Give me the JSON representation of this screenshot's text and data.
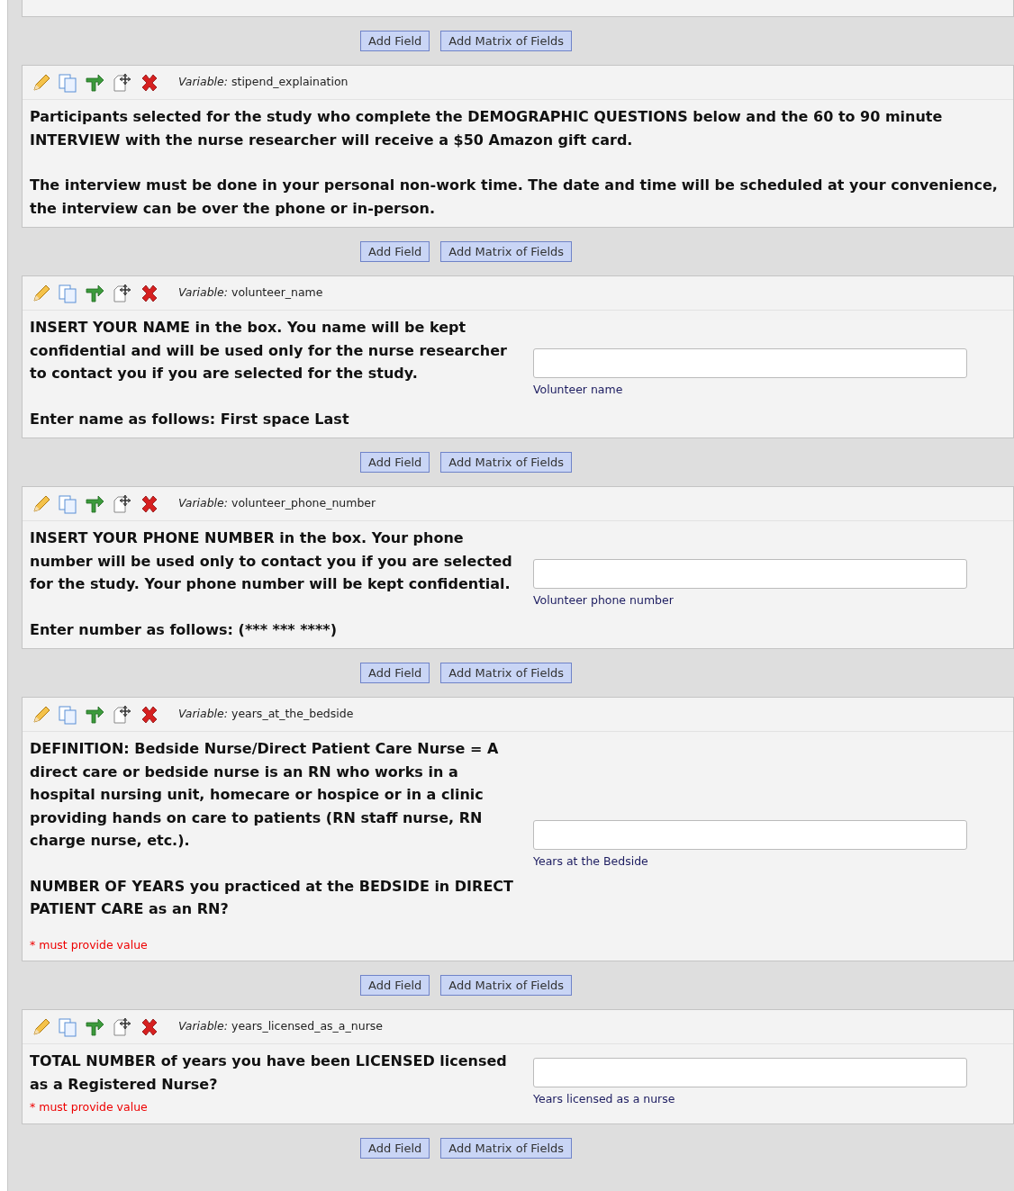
{
  "items": [
    {
      "kind": "stub"
    },
    {
      "kind": "buttons",
      "buttons": [
        "Add Field",
        "Add Matrix of Fields"
      ]
    },
    {
      "kind": "descriptive",
      "variable_label": "Variable:",
      "variable": "stipend_explaination",
      "paragraphs": [
        "Participants selected for the study who complete the DEMOGRAPHIC QUESTIONS below and the 60 to 90 minute INTERVIEW with the nurse researcher will receive a $50 Amazon gift card.",
        "The interview must be done in your personal non-work time. The date and time will be scheduled at your convenience, the interview can be over the phone or in-person."
      ]
    },
    {
      "kind": "buttons",
      "buttons": [
        "Add Field",
        "Add Matrix of Fields"
      ]
    },
    {
      "kind": "text",
      "variable_label": "Variable:",
      "variable": "volunteer_name",
      "paragraphs": [
        "INSERT YOUR NAME in the box. You name will be kept confidential and will be used only for the nurse researcher to contact you if you are selected for the study.",
        "Enter name as follows: First space Last"
      ],
      "field_note": "Volunteer name",
      "required": false
    },
    {
      "kind": "buttons",
      "buttons": [
        "Add Field",
        "Add Matrix of Fields"
      ]
    },
    {
      "kind": "text",
      "variable_label": "Variable:",
      "variable": "volunteer_phone_number",
      "paragraphs": [
        "INSERT YOUR PHONE NUMBER in the box. Your phone number will be used only to contact you if you are selected for the study. Your phone number will be kept confidential.",
        "Enter number as follows: (*** *** ****)"
      ],
      "field_note": "Volunteer phone number",
      "required": false
    },
    {
      "kind": "buttons",
      "buttons": [
        "Add Field",
        "Add Matrix of Fields"
      ]
    },
    {
      "kind": "text",
      "variable_label": "Variable:",
      "variable": "years_at_the_bedside",
      "paragraphs": [
        "DEFINITION: Bedside Nurse/Direct Patient Care Nurse = A direct care or bedside nurse is an RN who works in a hospital nursing unit, homecare or hospice or in a clinic providing hands on care to patients (RN staff nurse, RN charge nurse, etc.).",
        "NUMBER OF YEARS you practiced at the BEDSIDE in DIRECT PATIENT CARE as an RN?"
      ],
      "field_note": "Years at the Bedside",
      "required": true,
      "required_text": "* must provide value"
    },
    {
      "kind": "buttons",
      "buttons": [
        "Add Field",
        "Add Matrix of Fields"
      ]
    },
    {
      "kind": "text",
      "variable_label": "Variable:",
      "variable": "years_licensed_as_a_nurse",
      "paragraphs": [
        "TOTAL NUMBER of years you have been LICENSED licensed as a Registered Nurse?"
      ],
      "field_note": "Years licensed as a nurse",
      "required": true,
      "required_text": "* must provide value"
    },
    {
      "kind": "buttons",
      "buttons": [
        "Add Field",
        "Add Matrix of Fields"
      ]
    }
  ]
}
